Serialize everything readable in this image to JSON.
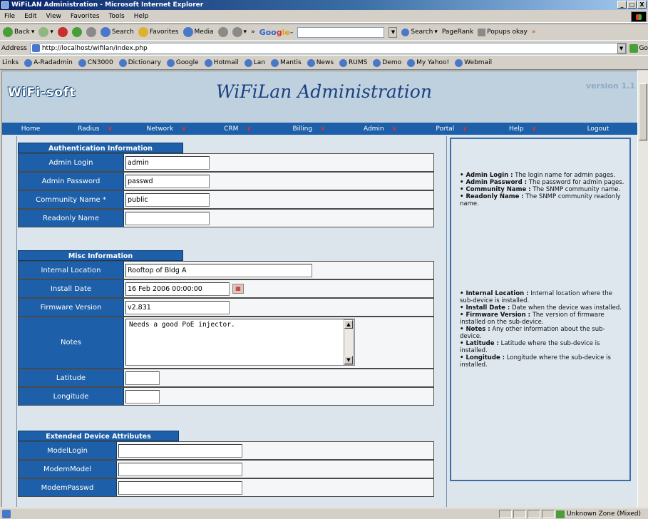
{
  "window": {
    "title": "WiFiLAN Administration - Microsoft Internet Explorer",
    "controls": [
      "_",
      "□",
      "X"
    ]
  },
  "menu": [
    "File",
    "Edit",
    "View",
    "Favorites",
    "Tools",
    "Help"
  ],
  "toolbar": {
    "back": "Back",
    "search": "Search",
    "favorites": "Favorites",
    "media": "Media",
    "more": "»",
    "google": [
      "Goo",
      "g",
      "le"
    ],
    "google_suffix": "-",
    "g_search": "Search",
    "pagerank": "PageRank",
    "popups": "Popups okay",
    "more2": "»"
  },
  "address": {
    "label": "Address",
    "url": "http://localhost/wifilan/index.php",
    "go": "Go"
  },
  "links": {
    "label": "Links",
    "items": [
      "A-Radadmin",
      "CN3000",
      "Dictionary",
      "Google",
      "Hotmail",
      "Lan",
      "Mantis",
      "News",
      "RUMS",
      "Demo",
      "My Yahoo!",
      "Webmail"
    ]
  },
  "header": {
    "logo": "WiFi-soft",
    "title": "WiFiLan Administration",
    "version": "version 1.1"
  },
  "nav": [
    {
      "label": "Home",
      "dropdown": false
    },
    {
      "label": "Radius",
      "dropdown": true
    },
    {
      "label": "Network",
      "dropdown": true
    },
    {
      "label": "CRM",
      "dropdown": true
    },
    {
      "label": "Billing",
      "dropdown": true
    },
    {
      "label": "Admin",
      "dropdown": true
    },
    {
      "label": "Portal",
      "dropdown": true
    },
    {
      "label": "Help",
      "dropdown": true
    },
    {
      "label": "Logout",
      "dropdown": false
    }
  ],
  "dropdown_glyph": "▼",
  "auth": {
    "title": "Authentication Information",
    "fields": [
      {
        "label": "Admin Login",
        "value": "admin"
      },
      {
        "label": "Admin Password",
        "value": "passwd"
      },
      {
        "label": "Community Name *",
        "value": "public"
      },
      {
        "label": "Readonly Name",
        "value": ""
      }
    ]
  },
  "misc": {
    "title": "Misc Information",
    "fields": [
      {
        "label": "Internal Location",
        "value": "Rooftop of Bldg A"
      },
      {
        "label": "Install Date",
        "value": "16 Feb 2006 00:00:00"
      },
      {
        "label": "Firmware Version",
        "value": "v2.831"
      },
      {
        "label": "Notes",
        "value": "Needs a good PoE injector."
      },
      {
        "label": "Latitude",
        "value": ""
      },
      {
        "label": "Longitude",
        "value": ""
      }
    ]
  },
  "extended": {
    "title": "Extended Device Attributes",
    "fields": [
      {
        "label": "ModelLogin",
        "value": ""
      },
      {
        "label": "ModemModel",
        "value": ""
      },
      {
        "label": "ModemPasswd",
        "value": ""
      }
    ]
  },
  "help_auth": [
    {
      "term": "Admin Login :",
      "desc": "The login name for admin pages."
    },
    {
      "term": "Admin Password :",
      "desc": "The password for admin pages."
    },
    {
      "term": "Community Name :",
      "desc": "The SNMP community name."
    },
    {
      "term": "Readonly Name :",
      "desc": "The SNMP community readonly name."
    }
  ],
  "help_misc": [
    {
      "term": "Internal Location :",
      "desc": "Internal location where the sub-device is installed."
    },
    {
      "term": "Install Date :",
      "desc": "Date when the device was installed."
    },
    {
      "term": "Firmware Version :",
      "desc": "The version of firmware installed on the sub-device."
    },
    {
      "term": "Notes :",
      "desc": "Any other information about the sub-device."
    },
    {
      "term": "Latitude :",
      "desc": "Latitude where the sub-device is installed."
    },
    {
      "term": "Longitude :",
      "desc": "Longitude where the sub-device is installed."
    }
  ],
  "help_bullet": "•",
  "status": {
    "zone": "Unknown Zone (Mixed)"
  }
}
